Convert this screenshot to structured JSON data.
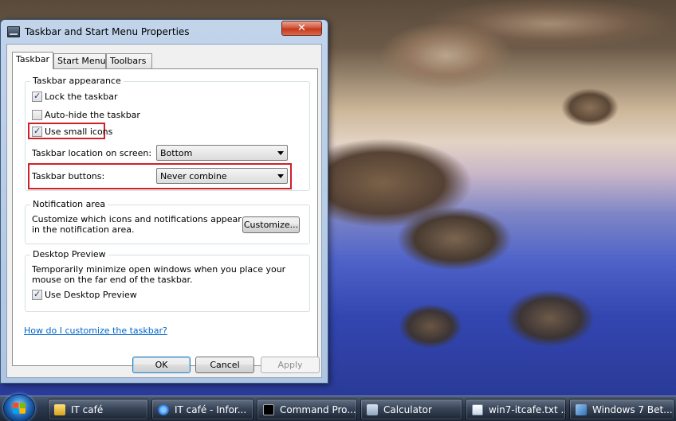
{
  "window": {
    "title": "Taskbar and Start Menu Properties",
    "close_symbol": "✕"
  },
  "tabs": [
    {
      "label": "Taskbar",
      "active": true
    },
    {
      "label": "Start Menu",
      "active": false
    },
    {
      "label": "Toolbars",
      "active": false
    }
  ],
  "appearance": {
    "legend": "Taskbar appearance",
    "lock_label": "Lock the taskbar",
    "lock_checked": true,
    "autohide_label": "Auto-hide the taskbar",
    "autohide_checked": false,
    "small_icons_label": "Use small icons",
    "small_icons_checked": true,
    "location_label": "Taskbar location on screen:",
    "location_value": "Bottom",
    "buttons_label": "Taskbar buttons:",
    "buttons_value": "Never combine"
  },
  "notification": {
    "legend": "Notification area",
    "description": "Customize which icons and notifications appear in the notification area.",
    "customize_label": "Customize..."
  },
  "preview": {
    "legend": "Desktop Preview",
    "description": "Temporarily minimize open windows when you place your mouse on the far end of the taskbar.",
    "use_label": "Use Desktop Preview",
    "use_checked": true
  },
  "help_link": "How do I customize the taskbar?",
  "buttons": {
    "ok": "OK",
    "cancel": "Cancel",
    "apply": "Apply"
  },
  "taskbar_items": [
    {
      "label": "IT café",
      "icon": "folder-icon"
    },
    {
      "label": "IT café - Infor...",
      "icon": "internet-explorer-icon"
    },
    {
      "label": "Command Pro...",
      "icon": "command-prompt-icon"
    },
    {
      "label": "Calculator",
      "icon": "calculator-icon"
    },
    {
      "label": "win7-itcafe.txt ...",
      "icon": "text-file-icon"
    },
    {
      "label": "Windows 7 Bet...",
      "icon": "windows-icon"
    }
  ],
  "colors": {
    "highlight_border": "#d0202a",
    "link": "#0066cc"
  }
}
